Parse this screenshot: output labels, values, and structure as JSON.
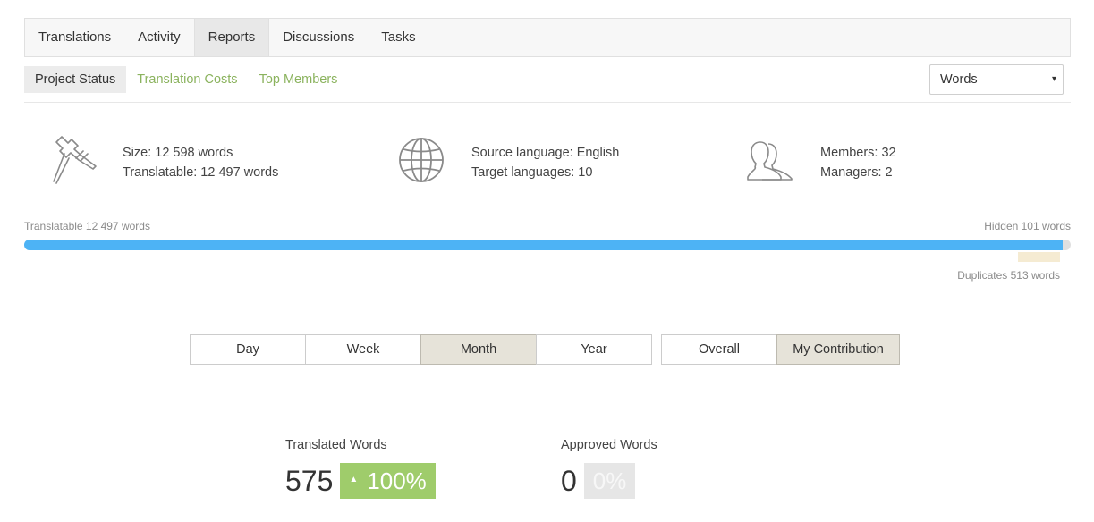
{
  "top_tabs": [
    "Translations",
    "Activity",
    "Reports",
    "Discussions",
    "Tasks"
  ],
  "active_top_tab": "Reports",
  "sub_tabs": [
    "Project Status",
    "Translation Costs",
    "Top Members"
  ],
  "active_sub_tab": "Project Status",
  "unit_select": {
    "value": "Words",
    "caret": "▾"
  },
  "stats": {
    "size": {
      "icon": "caliper-icon",
      "line1": "Size: 12 598 words",
      "line2": "Translatable: 12 497 words"
    },
    "languages": {
      "icon": "globe-icon",
      "line1": "Source language: English",
      "line2": "Target languages: 10"
    },
    "members": {
      "icon": "users-icon",
      "line1": "Members: 32",
      "line2": "Managers: 2"
    }
  },
  "progress": {
    "translatable_label": "Translatable 12 497 words",
    "hidden_label": "Hidden 101 words",
    "duplicates_label": "Duplicates 513 words",
    "translatable_fraction": 0.992,
    "color_fill": "#4db3f5",
    "color_track": "#e0e0e0",
    "color_duplicates": "#f5ebd2"
  },
  "period_buttons": [
    "Day",
    "Week",
    "Month",
    "Year"
  ],
  "active_period": "Month",
  "scope_buttons": [
    "Overall",
    "My Contribution"
  ],
  "active_scope": "My Contribution",
  "metrics": {
    "translated": {
      "label": "Translated Words",
      "value": "575",
      "badge": "100%",
      "arrow": "▲",
      "badge_color": "#9fcc6b"
    },
    "approved": {
      "label": "Approved Words",
      "value": "0",
      "badge": "0%",
      "badge_color": "#e6e6e6"
    }
  }
}
